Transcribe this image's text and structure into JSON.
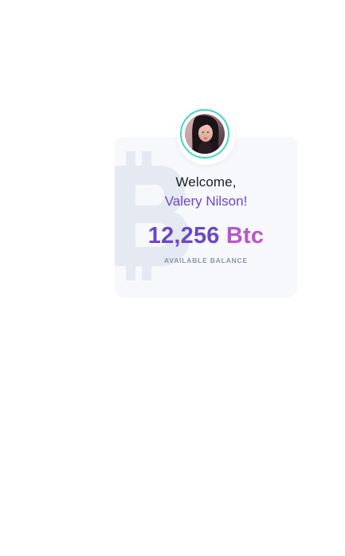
{
  "profile": {
    "greeting": "Welcome,",
    "user_name": "Valery Nilson!",
    "avatar_alt": "profile photo"
  },
  "wallet": {
    "balance_amount": "12,256",
    "balance_unit": "Btc",
    "balance_label": "AVAILABLE BALANCE"
  },
  "icons": {
    "watermark": "bitcoin-icon"
  },
  "colors": {
    "card_background": "#f6f8fc",
    "avatar_ring": "#3fd8c0",
    "accent_purple": "#6a47c4",
    "accent_pink": "#b957c9",
    "watermark": "#e4e9f2",
    "label_gray": "#8a93a8"
  }
}
